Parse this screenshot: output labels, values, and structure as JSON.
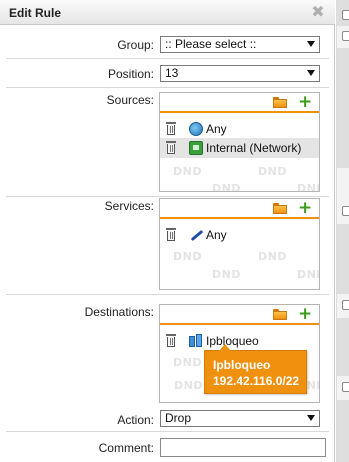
{
  "dialog": {
    "title": "Edit Rule",
    "close_glyph": "✖"
  },
  "fields": {
    "group": {
      "label": "Group:",
      "value": ":: Please select ::"
    },
    "position": {
      "label": "Position:",
      "value": "13"
    },
    "sources": {
      "label": "Sources:",
      "items": [
        {
          "name": "Any",
          "icon": "globe-icon"
        },
        {
          "name": "Internal (Network)",
          "icon": "network-icon"
        }
      ]
    },
    "services": {
      "label": "Services:",
      "items": [
        {
          "name": "Any",
          "icon": "service-icon"
        }
      ]
    },
    "destinations": {
      "label": "Destinations:",
      "items": [
        {
          "name": "Ipbloqueo",
          "icon": "host-icon"
        }
      ]
    },
    "action": {
      "label": "Action:",
      "value": "Drop"
    },
    "comment": {
      "label": "Comment:",
      "value": ""
    }
  },
  "dnd_text": "DND",
  "tooltip": {
    "name": "Ipbloqueo",
    "address": "192.42.116.0/22"
  },
  "colors": {
    "accent": "#f0900f",
    "add_green": "#3c9c1c"
  }
}
